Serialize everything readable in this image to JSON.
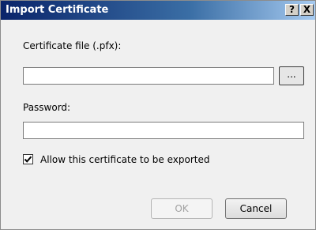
{
  "window": {
    "title": "Import Certificate",
    "help_label": "?",
    "close_label": "X"
  },
  "form": {
    "certificate_file_label": "Certificate file (.pfx):",
    "certificate_file_value": "",
    "browse_label": "...",
    "password_label": "Password:",
    "password_value": "",
    "allow_export_label": "Allow this certificate to be exported",
    "allow_export_checked": true
  },
  "buttons": {
    "ok_label": "OK",
    "ok_enabled": false,
    "cancel_label": "Cancel"
  }
}
